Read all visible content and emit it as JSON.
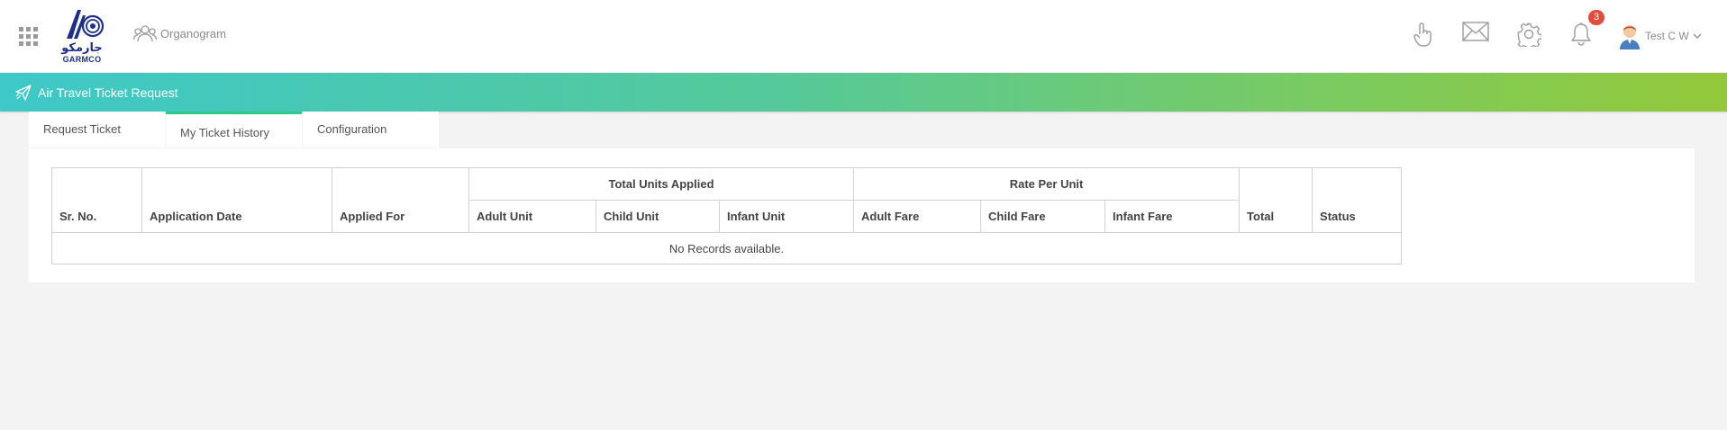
{
  "header": {
    "apps_icon": "grid-icon",
    "logo": {
      "arabic_text": "جارمكو",
      "name": "GARMCO"
    },
    "organogram_label": "Organogram",
    "icons": [
      "touch-icon",
      "mail-icon",
      "gear-icon",
      "bell-icon"
    ],
    "notification_count": "3",
    "user_name": "Test C W"
  },
  "band": {
    "title": "Air Travel Ticket Request",
    "icon": "paper-plane-icon"
  },
  "tabs": [
    {
      "label": "Request Ticket",
      "active": false
    },
    {
      "label": "My Ticket History",
      "active": true
    },
    {
      "label": "Configuration",
      "active": false
    }
  ],
  "table": {
    "groups": {
      "units": "Total Units Applied",
      "rate": "Rate Per Unit"
    },
    "columns": {
      "sr_no": "Sr. No.",
      "application_date": "Application Date",
      "applied_for": "Applied For",
      "adult_unit": "Adult Unit",
      "child_unit": "Child Unit",
      "infant_unit": "Infant Unit",
      "adult_fare": "Adult Fare",
      "child_fare": "Child Fare",
      "infant_fare": "Infant Fare",
      "total": "Total",
      "status": "Status"
    },
    "empty_message": "No Records available."
  },
  "colors": {
    "band_start": "#3ec8c8",
    "band_end": "#94c83a",
    "active_tab_accent": "#2fc98a",
    "badge": "#e24c3b",
    "logo_blue": "#1d2f8a"
  }
}
